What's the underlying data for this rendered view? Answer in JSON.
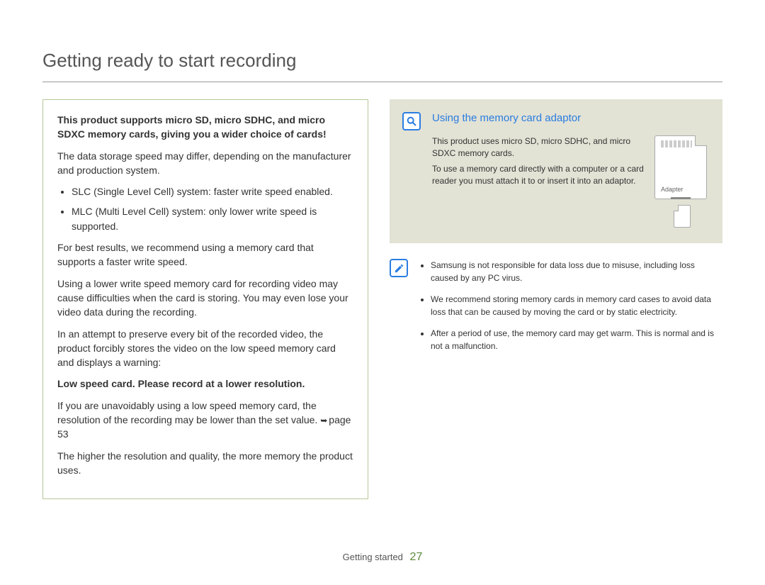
{
  "heading": "Getting ready to start recording",
  "left": {
    "intro_bold": "This product supports micro SD, micro SDHC, and micro SDXC memory cards, giving you a wider choice of cards!",
    "p1": "The data storage speed may differ, depending on the manufacturer and production system.",
    "bullets": [
      "SLC (Single Level Cell) system: faster write speed enabled.",
      "MLC (Multi Level Cell) system: only lower write speed is supported."
    ],
    "p2": "For best results, we recommend using a memory card that supports a faster write speed.",
    "p3": "Using a lower write speed memory card for recording video may cause difficulties when the card is storing. You may even lose your video data during the recording.",
    "p4": "In an attempt to preserve every bit of the recorded video, the product forcibly stores the video on the low speed memory card and displays a warning:",
    "warning_bold": "Low speed card. Please record at a lower resolution.",
    "p5": "If you are unavoidably using a low speed memory card, the resolution of the recording may be lower than the set value. ",
    "page_ref": "page 53",
    "p6": "The higher the resolution and quality, the more memory the product uses."
  },
  "right": {
    "adaptor_title": "Using the memory card adaptor",
    "adaptor_p1": "This product uses micro SD, micro SDHC, and micro SDXC memory cards.",
    "adaptor_p2": "To use a memory card directly with a computer or a card reader you must attach it to or insert it into an adaptor.",
    "adapter_label": "Adapter",
    "info": [
      "Samsung is not responsible for data loss due to misuse, including loss caused by any PC virus.",
      "We recommend storing memory cards in memory card cases to avoid data loss that can be caused by moving the card or by static electricity.",
      "After a period of use, the memory card may get warm. This is normal and is not a malfunction."
    ]
  },
  "footer": {
    "section": "Getting started",
    "page_number": "27"
  }
}
